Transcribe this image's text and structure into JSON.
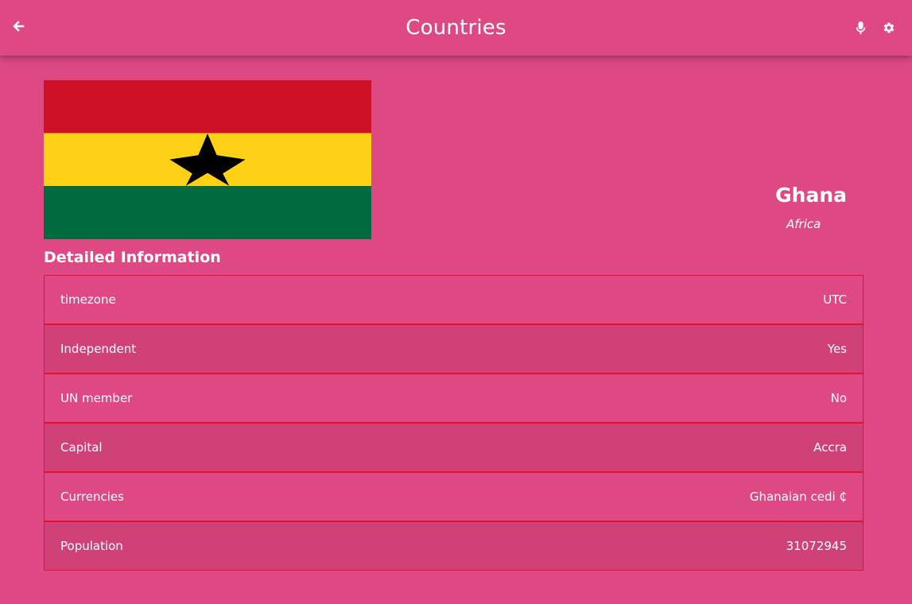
{
  "app": {
    "title": "Countries",
    "icons": {
      "back": "arrow-left-icon",
      "mic": "microphone-icon",
      "settings": "gear-icon"
    }
  },
  "country": {
    "name": "Ghana",
    "region": "Africa",
    "flag": {
      "colors": [
        "#ce1126",
        "#fcd116",
        "#006b3f"
      ],
      "star_color": "#000000"
    }
  },
  "details": {
    "title": "Detailed Information",
    "rows": [
      {
        "label": "timezone",
        "value": "UTC"
      },
      {
        "label": "Independent",
        "value": "Yes"
      },
      {
        "label": "UN member",
        "value": "No"
      },
      {
        "label": "Capital",
        "value": "Accra"
      },
      {
        "label": "Currencies",
        "value": "Ghanaian cedi ₵"
      },
      {
        "label": "Population",
        "value": "31072945"
      }
    ]
  },
  "theme": {
    "background": "#de4984",
    "row_alt": "#cf4177",
    "row_border": "#e8112d"
  }
}
